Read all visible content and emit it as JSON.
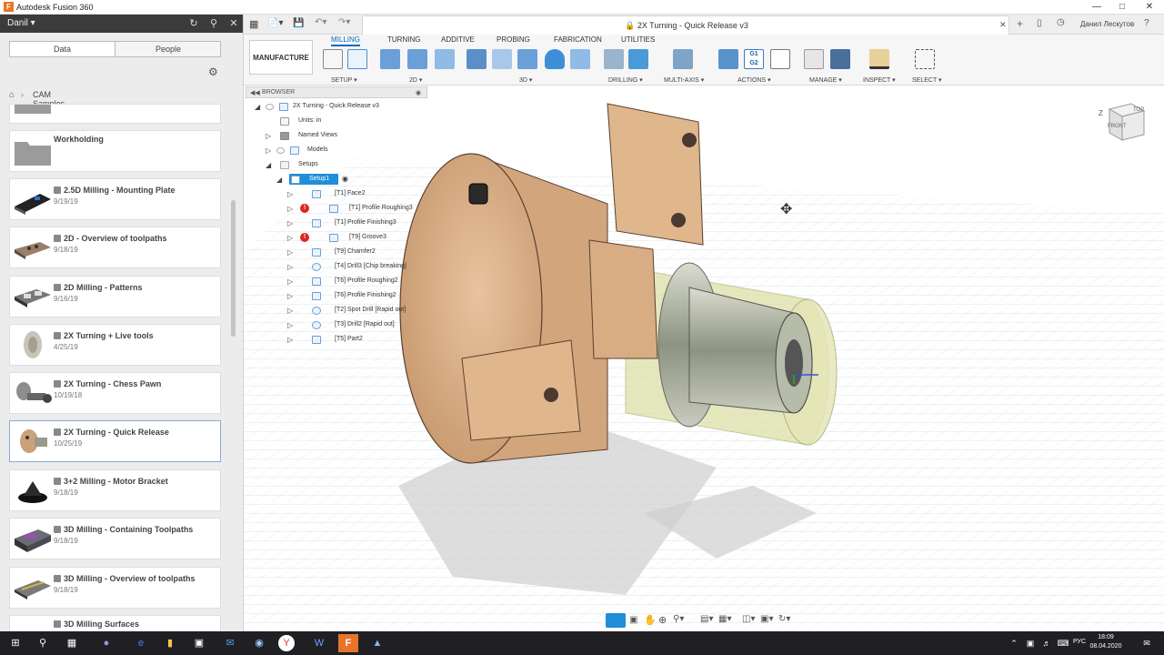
{
  "window": {
    "title": "Autodesk Fusion 360"
  },
  "left_panel": {
    "user": "Danil",
    "tabs": [
      "Data",
      "People"
    ],
    "breadcrumb": "CAM Samples",
    "items": [
      {
        "title": "",
        "date": ""
      },
      {
        "title": "Workholding",
        "date": ""
      },
      {
        "title": "2.5D Milling - Mounting Plate",
        "date": "9/19/19"
      },
      {
        "title": "2D - Overview of toolpaths",
        "date": "9/18/19"
      },
      {
        "title": "2D Milling - Patterns",
        "date": "9/16/19"
      },
      {
        "title": "2X Turning + Live tools",
        "date": "4/25/19"
      },
      {
        "title": "2X Turning - Chess Pawn",
        "date": "10/19/18"
      },
      {
        "title": "2X Turning - Quick Release",
        "date": "10/25/19"
      },
      {
        "title": "3+2 Milling - Motor Bracket",
        "date": "9/18/19"
      },
      {
        "title": "3D Milling - Containing Toolpaths",
        "date": "9/18/19"
      },
      {
        "title": "3D Milling - Overview of toolpaths",
        "date": "9/18/19"
      },
      {
        "title": "3D Milling Surfaces",
        "date": ""
      }
    ]
  },
  "document": {
    "title": "2X Turning - Quick Release v3",
    "user": "Данил Лескутов"
  },
  "toolbar": {
    "workspace": "MANUFACTURE",
    "tabs": [
      "MILLING",
      "TURNING",
      "ADDITIVE",
      "PROBING",
      "FABRICATION",
      "UTILITIES"
    ],
    "groups": [
      "SETUP",
      "2D",
      "3D",
      "DRILLING",
      "MULTI-AXIS",
      "ACTIONS",
      "MANAGE",
      "INSPECT",
      "SELECT"
    ]
  },
  "browser": {
    "header": "BROWSER",
    "items": [
      {
        "label": "2X Turning - Quick Release v3",
        "depth": 0,
        "error": false
      },
      {
        "label": "Units: in",
        "depth": 1,
        "error": false
      },
      {
        "label": "Named Views",
        "depth": 1,
        "error": false
      },
      {
        "label": "Models",
        "depth": 1,
        "error": false
      },
      {
        "label": "Setups",
        "depth": 1,
        "error": false
      },
      {
        "label": "Setup1",
        "depth": 2,
        "error": false
      },
      {
        "label": "[T1] Face2",
        "depth": 3,
        "error": false
      },
      {
        "label": "[T1] Profile Roughing3",
        "depth": 3,
        "error": true
      },
      {
        "label": "[T1] Profile Finishing3",
        "depth": 3,
        "error": false
      },
      {
        "label": "[T9] Groove3",
        "depth": 3,
        "error": true
      },
      {
        "label": "[T9] Chamfer2",
        "depth": 3,
        "error": false
      },
      {
        "label": "[T4] Drill3 [Chip breaking]",
        "depth": 3,
        "error": false
      },
      {
        "label": "[T6] Profile Roughing2",
        "depth": 3,
        "error": false
      },
      {
        "label": "[T6] Profile Finishing2",
        "depth": 3,
        "error": false
      },
      {
        "label": "[T2] Spot Drill [Rapid out]",
        "depth": 3,
        "error": false
      },
      {
        "label": "[T3] Drill2 [Rapid out]",
        "depth": 3,
        "error": false
      },
      {
        "label": "[T5] Part2",
        "depth": 3,
        "error": false
      }
    ]
  },
  "viewcube": {
    "front": "FRONT",
    "top": "TOP",
    "axis_z": "Z"
  },
  "taskbar": {
    "lang": "РУС",
    "time": "18:09",
    "date": "08.04.2020"
  },
  "colors": {
    "accent": "#0a6bbf",
    "chuck": "#e0b68c",
    "stock": "#d7dba0",
    "error": "#d9271f"
  }
}
